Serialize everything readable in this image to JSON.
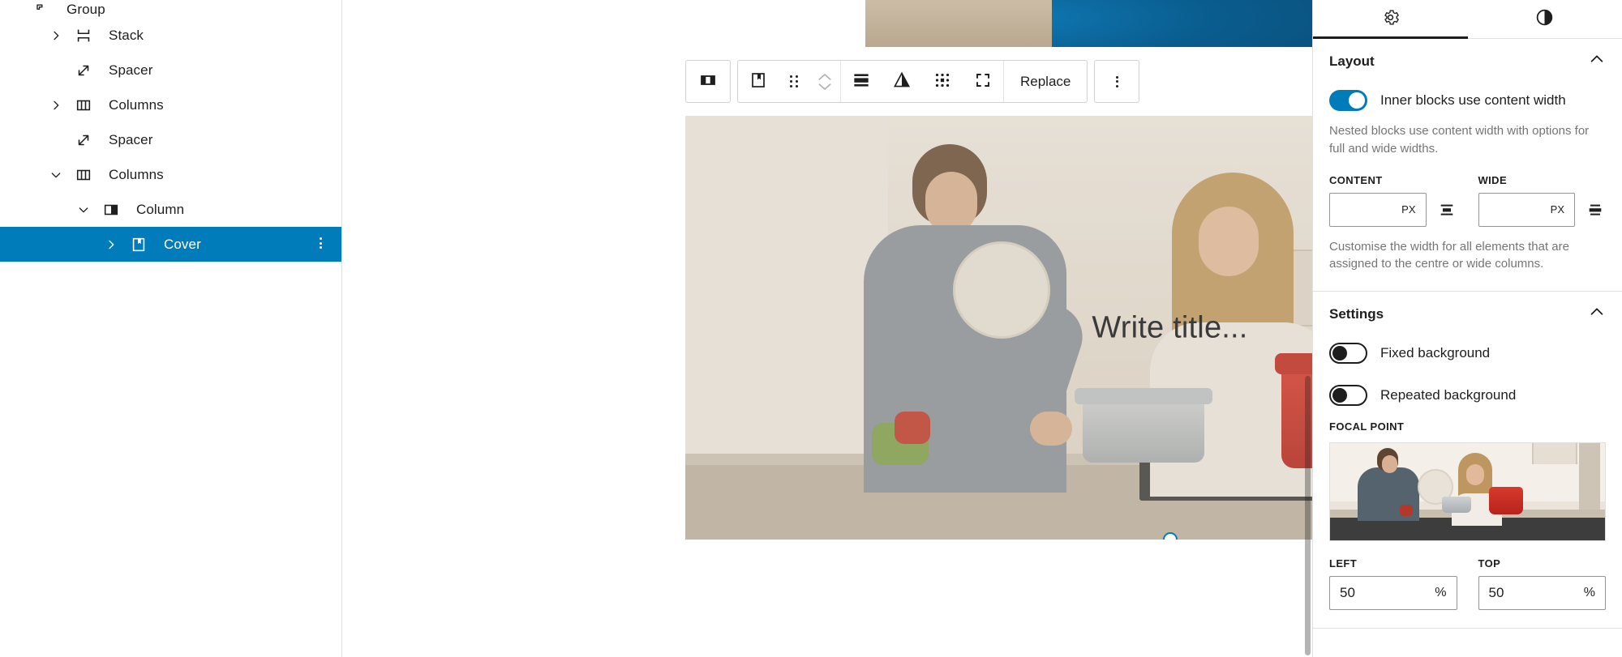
{
  "list_view": {
    "items": [
      {
        "label": "Group",
        "icon": "group-icon",
        "indent": 0,
        "chevron": "collapsed",
        "selected": false,
        "clipped": true
      },
      {
        "label": "Stack",
        "icon": "stack-icon",
        "indent": 1,
        "chevron": "collapsed",
        "selected": false
      },
      {
        "label": "Spacer",
        "icon": "spacer-icon",
        "indent": 2,
        "chevron": "none",
        "selected": false
      },
      {
        "label": "Columns",
        "icon": "columns-icon",
        "indent": 1,
        "chevron": "collapsed",
        "selected": false
      },
      {
        "label": "Spacer",
        "icon": "spacer-icon",
        "indent": 2,
        "chevron": "none",
        "selected": false
      },
      {
        "label": "Columns",
        "icon": "columns-icon",
        "indent": 1,
        "chevron": "expanded",
        "selected": false
      },
      {
        "label": "Column",
        "icon": "column-icon",
        "indent": 2,
        "chevron": "expanded",
        "selected": false
      },
      {
        "label": "Cover",
        "icon": "cover-icon",
        "indent": 3,
        "chevron": "collapsed",
        "selected": true
      }
    ],
    "selected_color": "#007cba",
    "more_options_label": "Options"
  },
  "toolbar": {
    "parent_block_label": "Select Column",
    "block_type_label": "Cover",
    "drag_label": "Drag",
    "move_up_label": "Move up",
    "move_down_label": "Move down",
    "align_label": "Align",
    "duotone_label": "Apply duotone filter",
    "focal_point_label": "Focal point",
    "full_size_label": "Toggle full height",
    "replace_label": "Replace",
    "options_label": "Options"
  },
  "canvas": {
    "cover_title_placeholder": "Write title...",
    "appender_label": "+",
    "resize_handle_label": "Drag to resize"
  },
  "inspector": {
    "tabs": [
      {
        "label": "Settings",
        "icon": "gear-icon",
        "active": true
      },
      {
        "label": "Styles",
        "icon": "contrast-icon",
        "active": false
      }
    ],
    "layout": {
      "title": "Layout",
      "collapse_state": "expanded",
      "inner_blocks_toggle": {
        "label": "Inner blocks use content width",
        "value": "on"
      },
      "help": "Nested blocks use content width with options for full and wide widths.",
      "content": {
        "label": "CONTENT",
        "value": "",
        "placeholder": "",
        "unit": "PX",
        "align_icon": "align-center-icon"
      },
      "wide": {
        "label": "WIDE",
        "value": "",
        "placeholder": "",
        "unit": "PX",
        "align_icon": "align-wide-icon"
      },
      "width_help": "Customise the width for all elements that are assigned to the centre or wide columns."
    },
    "settings": {
      "title": "Settings",
      "collapse_state": "expanded",
      "fixed_background": {
        "label": "Fixed background",
        "value": "off"
      },
      "repeated_background": {
        "label": "Repeated background",
        "value": "off"
      },
      "focal_point": {
        "label": "FOCAL POINT",
        "left": {
          "label": "LEFT",
          "value": "50",
          "unit": "%"
        },
        "top": {
          "label": "TOP",
          "value": "50",
          "unit": "%"
        }
      }
    }
  },
  "colors": {
    "accent": "#007cba",
    "text": "#1e1e1e",
    "muted": "#757575",
    "border": "#e0e0e0"
  }
}
